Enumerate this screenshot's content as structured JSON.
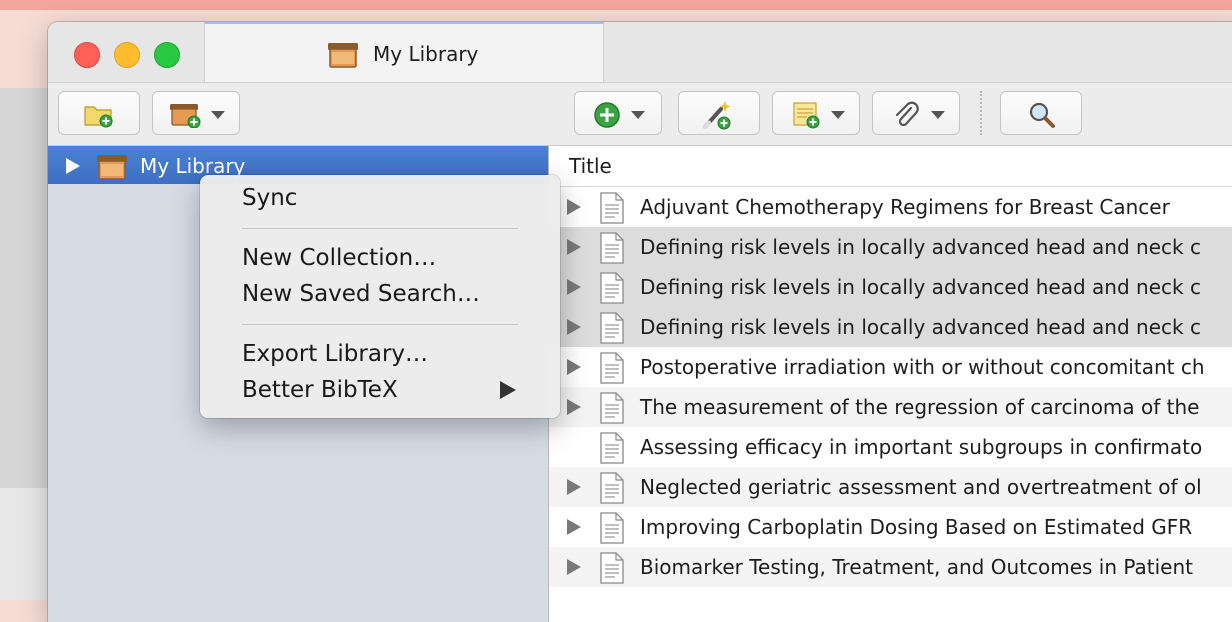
{
  "window": {
    "tab_title": "My Library"
  },
  "sidebar": {
    "library_label": "My Library"
  },
  "table": {
    "column_title": "Title",
    "rows": [
      "Adjuvant Chemotherapy Regimens for Breast Cancer",
      "Defining risk levels in locally advanced head and neck c",
      "Defining risk levels in locally advanced head and neck c",
      "Defining risk levels in locally advanced head and neck c",
      "Postoperative irradiation with or without concomitant ch",
      "The measurement of the regression of carcinoma of the",
      "Assessing efficacy in important subgroups in confirmato",
      "Neglected geriatric assessment and overtreatment of ol",
      "Improving Carboplatin Dosing Based on Estimated GFR",
      "Biomarker Testing, Treatment, and Outcomes in Patient"
    ]
  },
  "context_menu": {
    "sync": "Sync",
    "new_collection": "New Collection…",
    "new_saved_search": "New Saved Search…",
    "export_library": "Export Library…",
    "better_bibtex": "Better BibTeX"
  },
  "icons": {
    "new_collection": "folder-add-icon",
    "new_library": "library-add-icon",
    "new_item": "plus-circle-icon",
    "add_by_identifier": "magic-wand-icon",
    "new_note": "note-add-icon",
    "attachment": "paperclip-icon",
    "search": "magnifier-icon"
  }
}
